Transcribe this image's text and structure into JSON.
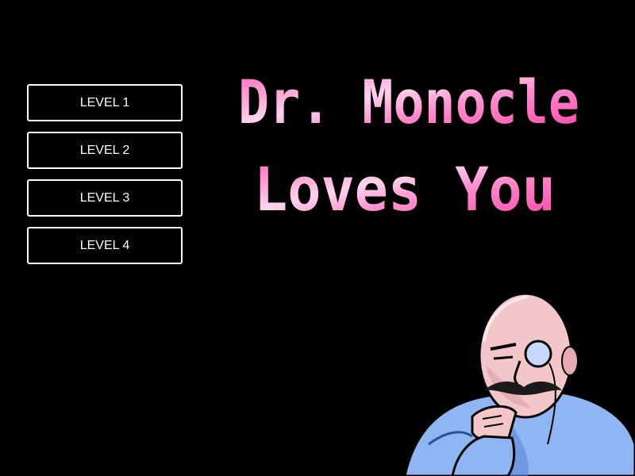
{
  "menu": {
    "levels": [
      {
        "label": "LEVEL 1"
      },
      {
        "label": "LEVEL 2"
      },
      {
        "label": "LEVEL 3"
      },
      {
        "label": "LEVEL 4"
      }
    ]
  },
  "title": {
    "line1": "Dr. Monocle",
    "line2": "Loves You",
    "colors": {
      "pink_light": "#ffb3e0",
      "pink_mid": "#ff7ac8",
      "pink_deep": "#ff3fa6",
      "white_glint": "#ffe6f6"
    }
  },
  "character": {
    "name_icon": "dr-monocle-portrait",
    "colors": {
      "skin": "#f3c6c9",
      "skin_shadow": "#d99aa3",
      "shirt": "#8fb6f2",
      "shirt_shadow": "#5b86d8",
      "mustache": "#1a1a1a",
      "monocle": "#c9d6ff"
    }
  }
}
